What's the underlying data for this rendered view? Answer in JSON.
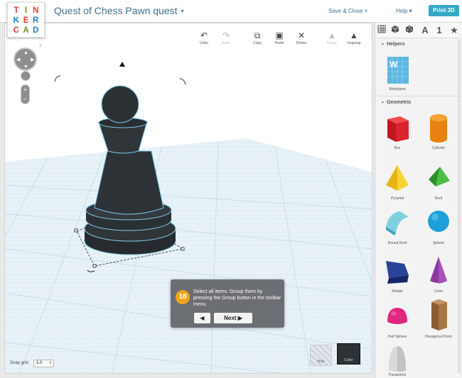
{
  "app": {
    "logo_letters": [
      "T",
      "I",
      "N",
      "K",
      "E",
      "R",
      "C",
      "A",
      "D"
    ],
    "logo_colors": [
      "#e33e2b",
      "#7f8c2b",
      "#e33e2b",
      "#1e7fb8",
      "#e33e2b",
      "#1e7fb8",
      "#e33e2b",
      "#7f8c2b",
      "#1e7fb8"
    ]
  },
  "header": {
    "title": "Quest of Chess Pawn quest",
    "title_caret": "▾",
    "save_close": "Save & Close ×",
    "help": "Help ▾",
    "print3d": "Print 3D"
  },
  "toolbar": {
    "undo": "Undo",
    "redo": "Redo",
    "copy": "Copy",
    "paste": "Paste",
    "delete": "Delete",
    "group": "Group",
    "ungroup": "Ungroup"
  },
  "nav": {
    "help_mark": "?",
    "zoom_in": "+",
    "zoom_out": "−"
  },
  "tooltip": {
    "step": "18",
    "text": "Select all items. Group them by pressing the Group button in the toolbar menu.",
    "prev": "◀",
    "next": "Next ▶"
  },
  "footer": {
    "snap_label": "Snap grid",
    "snap_value": "1.0",
    "hole": "Hole",
    "color": "Color"
  },
  "panel": {
    "tabs": [
      "grid-icon",
      "box-icon",
      "dice-icon",
      "A",
      "1",
      "★"
    ],
    "helpers": {
      "title": "Helpers",
      "items": [
        {
          "label": "Workplane",
          "icon": "workplane-icon"
        }
      ]
    },
    "geometric": {
      "title": "Geometric",
      "items": [
        {
          "label": "Box",
          "icon": "box-shape-icon",
          "color": "#d9232f"
        },
        {
          "label": "Cylinder",
          "icon": "cylinder-shape-icon",
          "color": "#f08a17"
        },
        {
          "label": "Pyramid",
          "icon": "pyramid-shape-icon",
          "color": "#f4c51c"
        },
        {
          "label": "Roof",
          "icon": "roof-shape-icon",
          "color": "#3ea83a"
        },
        {
          "label": "Round Roof",
          "icon": "round-roof-shape-icon",
          "color": "#5bbfd1"
        },
        {
          "label": "Sphere",
          "icon": "sphere-shape-icon",
          "color": "#1f9fd8"
        },
        {
          "label": "Wedge",
          "icon": "wedge-shape-icon",
          "color": "#233a8c"
        },
        {
          "label": "Cone",
          "icon": "cone-shape-icon",
          "color": "#8a3a9e"
        },
        {
          "label": "Half Sphere",
          "icon": "half-sphere-shape-icon",
          "color": "#e0277f"
        },
        {
          "label": "Hexagonal Prism",
          "icon": "hex-prism-shape-icon",
          "color": "#9a6a3f"
        },
        {
          "label": "Paraboloid",
          "icon": "paraboloid-shape-icon",
          "color": "#d8d8d8"
        }
      ]
    }
  }
}
